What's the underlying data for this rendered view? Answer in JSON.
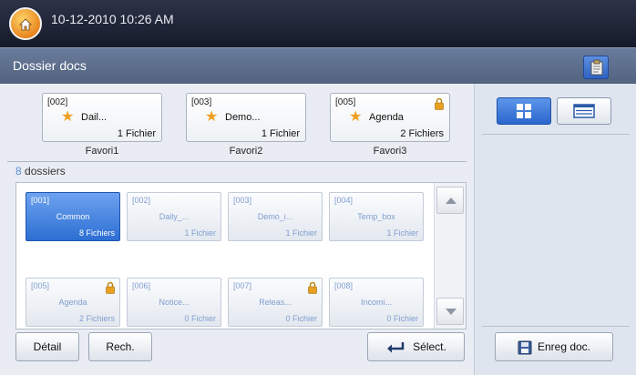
{
  "status_bar": {
    "datetime": "10-12-2010 10:26 AM"
  },
  "header": {
    "title": "Dossier docs"
  },
  "favorites": [
    {
      "code": "[002]",
      "name": "Dail...",
      "count": "1 Fichier",
      "label": "Favori1",
      "locked": false
    },
    {
      "code": "[003]",
      "name": "Demo...",
      "count": "1 Fichier",
      "label": "Favori2",
      "locked": false
    },
    {
      "code": "[005]",
      "name": "Agenda",
      "count": "2 Fichiers",
      "label": "Favori3",
      "locked": true
    }
  ],
  "folder_summary": {
    "count": "8",
    "label": "dossiers"
  },
  "folders": [
    {
      "code": "[001]",
      "name": "Common",
      "count": "8 Fichiers",
      "selected": true,
      "locked": false
    },
    {
      "code": "[002]",
      "name": "Daily_...",
      "count": "1 Fichier",
      "selected": false,
      "locked": false
    },
    {
      "code": "[003]",
      "name": "Demo_i...",
      "count": "1 Fichier",
      "selected": false,
      "locked": false
    },
    {
      "code": "[004]",
      "name": "Temp_box",
      "count": "1 Fichier",
      "selected": false,
      "locked": false
    },
    {
      "code": "[005]",
      "name": "Agenda",
      "count": "2 Fichiers",
      "selected": false,
      "locked": true
    },
    {
      "code": "[006]",
      "name": "Notice...",
      "count": "0 Fichier",
      "selected": false,
      "locked": false
    },
    {
      "code": "[007]",
      "name": "Releas...",
      "count": "0 Fichier",
      "selected": false,
      "locked": true
    },
    {
      "code": "[008]",
      "name": "Incomi...",
      "count": "0 Fichier",
      "selected": false,
      "locked": false
    }
  ],
  "actions": {
    "detail": "Détail",
    "search": "Rech.",
    "select": "Sélect.",
    "save_doc": "Enreg doc."
  },
  "icons": {
    "home": "home-icon",
    "clipboard": "clipboard-icon",
    "star": "star-icon",
    "lock": "lock-icon",
    "thumbnail_view": "grid-view-icon",
    "list_view": "list-view-icon",
    "enter": "enter-arrow-icon",
    "save": "floppy-disk-icon"
  },
  "colors": {
    "selection": "#2d6fd3",
    "folder_text": "#7f9ecf",
    "count_accent": "#5b8dd6",
    "lock": "#e8a020"
  }
}
